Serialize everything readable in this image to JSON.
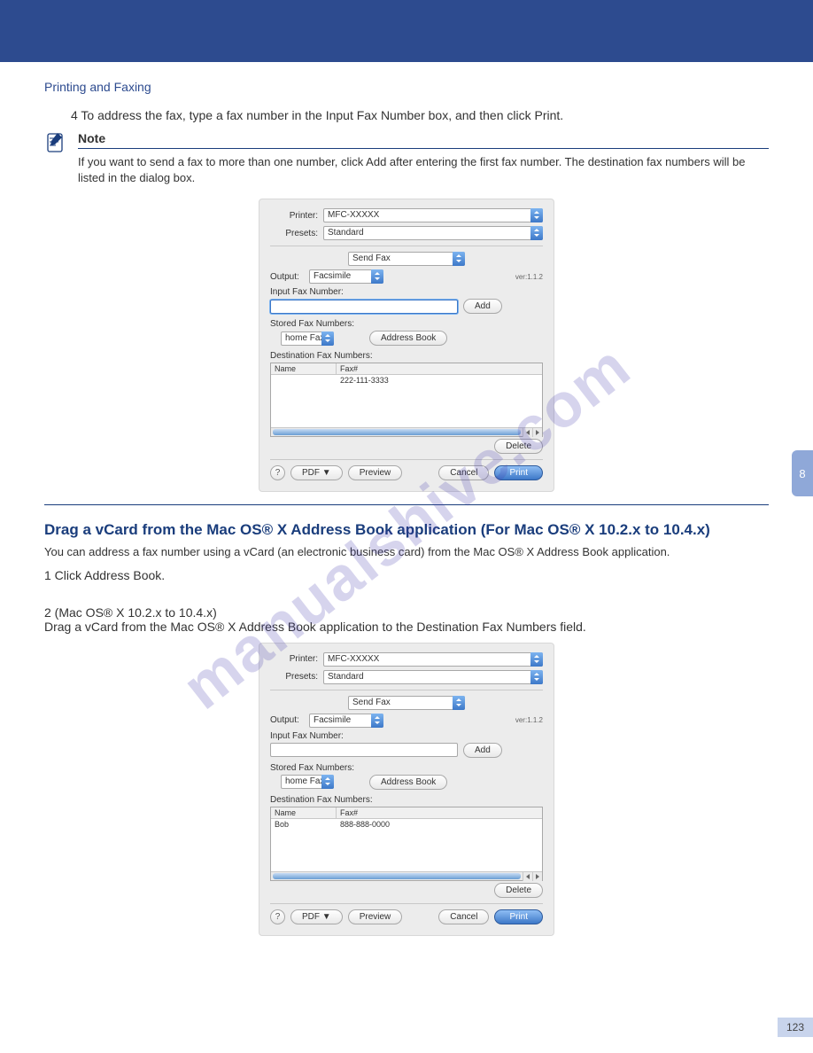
{
  "page_number": "123",
  "side_tab": "8",
  "header_breadcrumb": "Printing and Faxing",
  "step4": "4 To address the fax, type a fax number in the Input Fax Number box, and then click Print.",
  "note": {
    "title": "Note",
    "text": "If you want to send a fax to more than one number, click Add after entering the first fax number. The destination fax numbers will be listed in the dialog box."
  },
  "dialog1": {
    "printer_label": "Printer:",
    "printer_value": "MFC-XXXXX",
    "presets_label": "Presets:",
    "presets_value": "Standard",
    "panel_value": "Send Fax",
    "output_label": "Output:",
    "output_value": "Facsimile",
    "version": "ver:1.1.2",
    "input_label": "Input Fax Number:",
    "add_btn": "Add",
    "stored_label": "Stored Fax Numbers:",
    "stored_value": "home Fax",
    "addrbook_btn": "Address Book",
    "dest_label": "Destination Fax Numbers:",
    "col_name": "Name",
    "col_fax": "Fax#",
    "row_name": "",
    "row_fax": "222-111-3333",
    "delete_btn": "Delete",
    "help": "?",
    "pdf_btn": "PDF ▼",
    "preview_btn": "Preview",
    "cancel_btn": "Cancel",
    "print_btn": "Print"
  },
  "vcard": {
    "title": "Drag a vCard from the Mac OS® X Address Book application (For Mac OS® X 10.2.x to 10.4.x)",
    "para": "You can address a fax number using a vCard (an electronic business card) from the Mac OS® X Address Book application.",
    "step1": "1 Click Address Book.",
    "step2": "2 (Mac OS® X 10.2.x to 10.4.x)\nDrag a vCard from the Mac OS® X Address Book application to the Destination Fax Numbers field."
  },
  "dialog2": {
    "printer_label": "Printer:",
    "printer_value": "MFC-XXXXX",
    "presets_label": "Presets:",
    "presets_value": "Standard",
    "panel_value": "Send Fax",
    "output_label": "Output:",
    "output_value": "Facsimile",
    "version": "ver:1.1.2",
    "input_label": "Input Fax Number:",
    "add_btn": "Add",
    "stored_label": "Stored Fax Numbers:",
    "stored_value": "home Fax",
    "addrbook_btn": "Address Book",
    "dest_label": "Destination Fax Numbers:",
    "col_name": "Name",
    "col_fax": "Fax#",
    "row_name": "Bob",
    "row_fax": "888-888-0000",
    "delete_btn": "Delete",
    "help": "?",
    "pdf_btn": "PDF ▼",
    "preview_btn": "Preview",
    "cancel_btn": "Cancel",
    "print_btn": "Print"
  },
  "watermark": "manualshive.com"
}
